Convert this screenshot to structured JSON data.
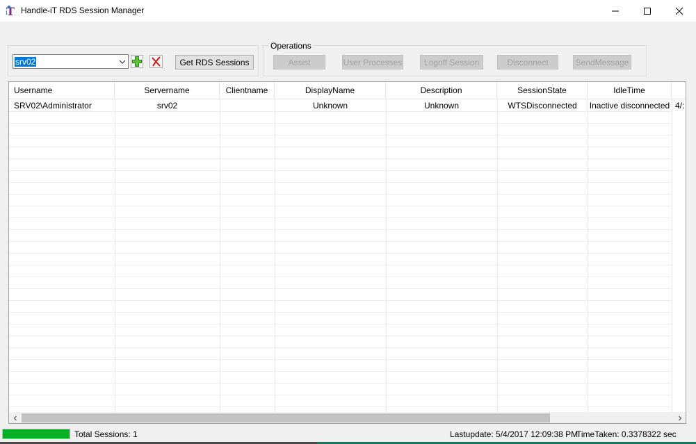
{
  "window": {
    "title": "Handle-iT RDS Session Manager",
    "icon": "handle-it-logo-icon"
  },
  "server": {
    "selected": "srv02",
    "get_sessions_label": "Get RDS Sessions"
  },
  "operations": {
    "group_label": "Operations",
    "assist": "Assist",
    "user_processes": "User Processes",
    "logoff_session": "Logoff Session",
    "disconnect": "Disconnect",
    "send_message": "SendMessage"
  },
  "grid": {
    "columns": [
      "Username",
      "Servername",
      "Clientname",
      "DisplayName",
      "Description",
      "SessionState",
      "IdleTime",
      ""
    ],
    "rows": [
      [
        "SRV02\\Administrator",
        "srv02",
        "",
        "Unknown",
        "Unknown",
        "WTSDisconnected",
        "Inactive disconnected",
        "4/:"
      ]
    ]
  },
  "status": {
    "progress": 1.0,
    "progress_color": "#06b025",
    "total_sessions": "Total Sessions: 1",
    "lastupdate": "Lastupdate: 5/4/2017 12:09:38 PM",
    "timetaken": "TimeTaken: 0.3378322 sec"
  }
}
